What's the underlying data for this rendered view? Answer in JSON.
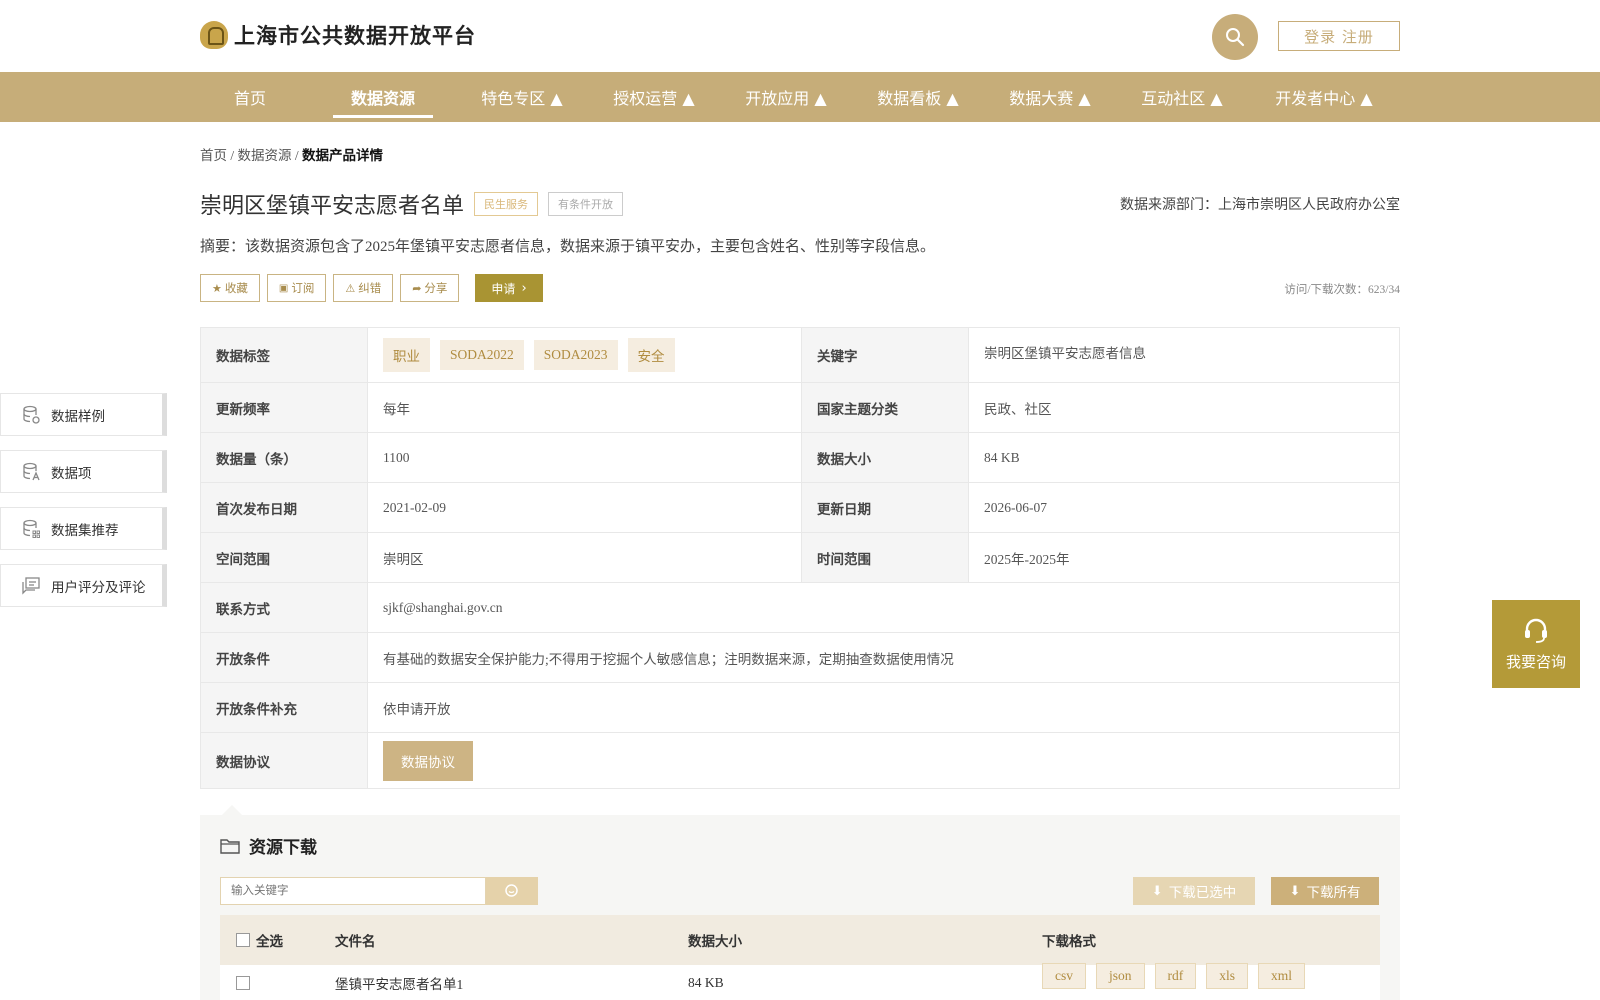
{
  "header": {
    "site_name": "上海市公共数据开放平台",
    "login_register": "登录 注册"
  },
  "nav": {
    "items": [
      {
        "label": "首页"
      },
      {
        "label": "数据资源"
      },
      {
        "label": "特色专区 ▲"
      },
      {
        "label": "授权运营 ▲"
      },
      {
        "label": "开放应用 ▲"
      },
      {
        "label": "数据看板 ▲"
      },
      {
        "label": "数据大赛 ▲"
      },
      {
        "label": "互动社区 ▲"
      },
      {
        "label": "开发者中心 ▲"
      }
    ]
  },
  "breadcrumb": {
    "home": "首页",
    "sep1": " / ",
    "section": "数据资源",
    "sep2": " / ",
    "current": "数据产品详情"
  },
  "dataset": {
    "title": "崇明区堡镇平安志愿者名单",
    "tag_service": "民生服务",
    "tag_open": "有条件开放",
    "source_dept": "数据来源部门：上海市崇明区人民政府办公室",
    "summary": "摘要：该数据资源包含了2025年堡镇平安志愿者信息，数据来源于镇平安办，主要包含姓名、性别等字段信息。",
    "visit_count": "访问/下载次数：623/34"
  },
  "actions": {
    "favorite": "收藏",
    "subscribe": "订阅",
    "correct": "纠错",
    "share": "分享",
    "apply": "申请"
  },
  "sidebar": {
    "items": [
      {
        "label": "数据样例"
      },
      {
        "label": "数据项"
      },
      {
        "label": "数据集推荐"
      },
      {
        "label": "用户评分及评论"
      }
    ]
  },
  "info": {
    "labels_label": "数据标签",
    "tags": [
      "职业",
      "SODA2022",
      "SODA2023",
      "安全"
    ],
    "keyword_label": "关键字",
    "keyword_value": "崇明区堡镇平安志愿者信息",
    "freq_label": "更新频率",
    "freq_value": "每年",
    "theme_label": "国家主题分类",
    "theme_value": "民政、社区",
    "count_label": "数据量（条）",
    "count_value": "1100",
    "size_label": "数据大小",
    "size_value": "84 KB",
    "first_date_label": "首次发布日期",
    "first_date_value": "2021-02-09",
    "update_date_label": "更新日期",
    "update_date_value": "2026-06-07",
    "space_label": "空间范围",
    "space_value": "崇明区",
    "time_label": "时间范围",
    "time_value": "2025年-2025年",
    "contact_label": "联系方式",
    "contact_value": "sjkf@shanghai.gov.cn",
    "cond_label": "开放条件",
    "cond_value": "有基础的数据安全保护能力;不得用于挖掘个人敏感信息；注明数据来源，定期抽查数据使用情况",
    "cond_extra_label": "开放条件补充",
    "cond_extra_value": "依申请开放",
    "protocol_label": "数据协议",
    "protocol_button": "数据协议"
  },
  "consult": {
    "label": "我要咨询"
  },
  "resource": {
    "title": "资源下载",
    "search_placeholder": "输入关键字",
    "download_selected": "下载已选中",
    "download_all": "下载所有",
    "col_select_all": "全选",
    "col_filename": "文件名",
    "col_size": "数据大小",
    "col_format": "下载格式",
    "rows": [
      {
        "filename": "堡镇平安志愿者名单1",
        "size": "84 KB",
        "formats": [
          "csv",
          "json",
          "rdf",
          "xls",
          "xml"
        ]
      }
    ]
  },
  "colors": {
    "brand_gold": "#c6ad79",
    "apply_olive": "#a99433",
    "consult_gold": "#b49a38"
  }
}
